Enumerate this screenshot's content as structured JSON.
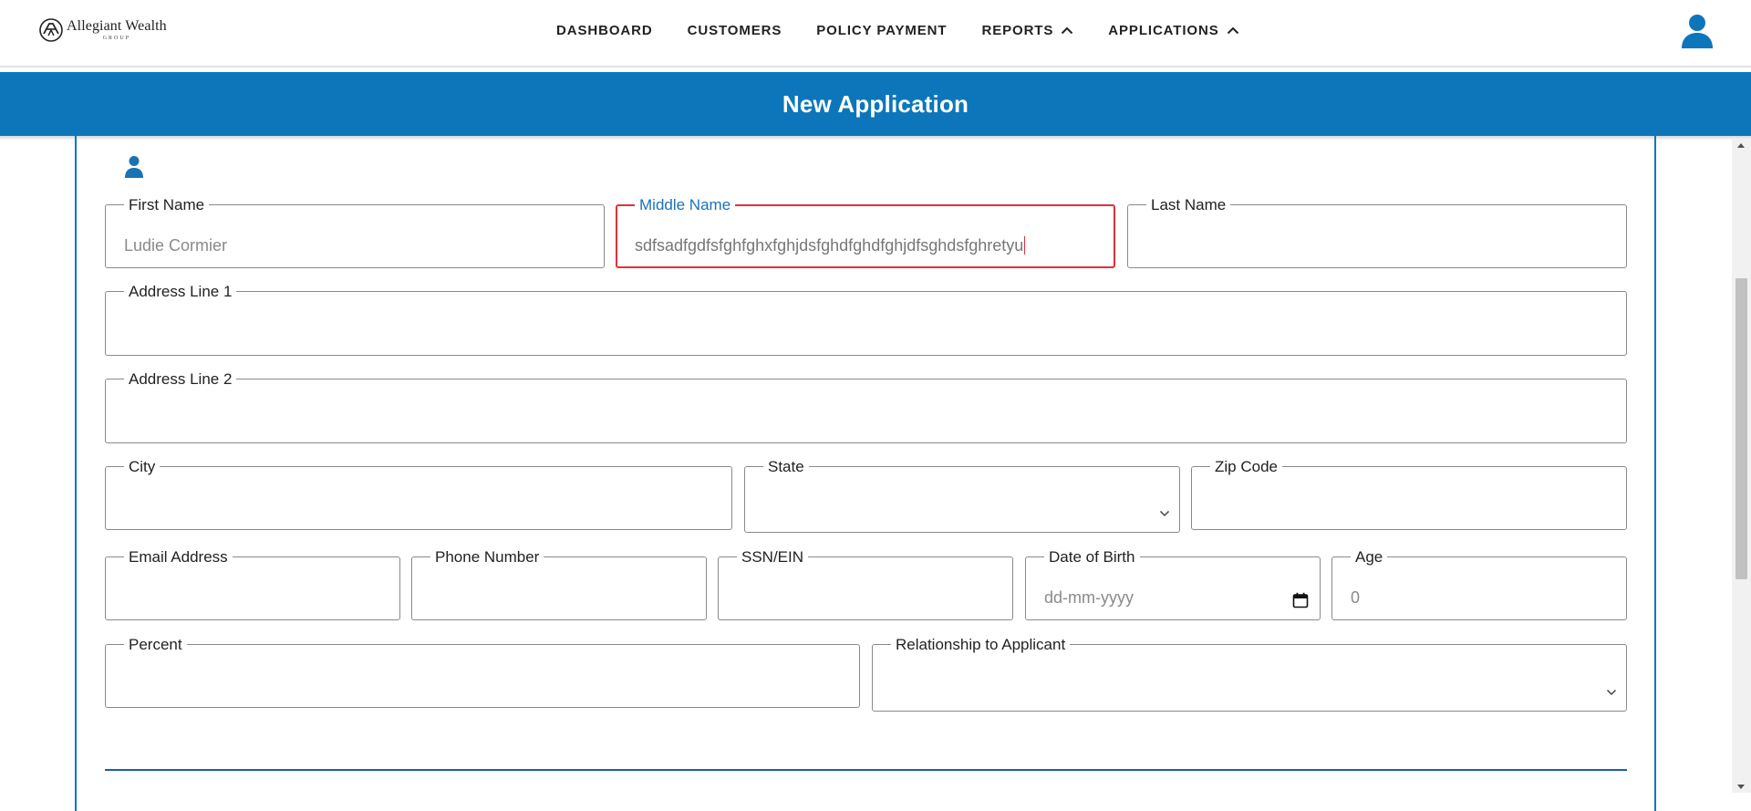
{
  "brand": {
    "name": "Allegiant Wealth",
    "subtitle": "GROUP"
  },
  "nav": {
    "items": [
      {
        "label": "DASHBOARD"
      },
      {
        "label": "CUSTOMERS"
      },
      {
        "label": "POLICY PAYMENT"
      },
      {
        "label": "REPORTS",
        "icon": "chevron-up-icon"
      },
      {
        "label": "APPLICATIONS",
        "icon": "chevron-up-icon"
      }
    ]
  },
  "page": {
    "title": "New Application"
  },
  "colors": {
    "brand_blue": "#0d76bb",
    "focus_red": "#e0303c",
    "focus_label": "#1a72b5"
  },
  "form": {
    "first_name": {
      "label": "First Name",
      "placeholder": "Ludie Cormier"
    },
    "middle_name": {
      "label": "Middle Name",
      "value": "sdfsadfgdfsfghfghxfghjdsfghdfghdfghjdfsghdsfghretyu"
    },
    "last_name": {
      "label": "Last Name",
      "value": ""
    },
    "address1": {
      "label": "Address Line 1",
      "value": ""
    },
    "address2": {
      "label": "Address Line 2",
      "value": ""
    },
    "city": {
      "label": "City",
      "value": ""
    },
    "state": {
      "label": "State",
      "value": ""
    },
    "zip": {
      "label": "Zip Code",
      "value": ""
    },
    "email": {
      "label": "Email Address",
      "value": ""
    },
    "phone": {
      "label": "Phone Number",
      "value": ""
    },
    "ssn": {
      "label": "SSN/EIN",
      "value": ""
    },
    "dob": {
      "label": "Date of Birth",
      "placeholder": "dd-mm-yyyy"
    },
    "age": {
      "label": "Age",
      "value": "0"
    },
    "percent": {
      "label": "Percent",
      "value": ""
    },
    "relationship": {
      "label": "Relationship to Applicant",
      "value": ""
    }
  }
}
